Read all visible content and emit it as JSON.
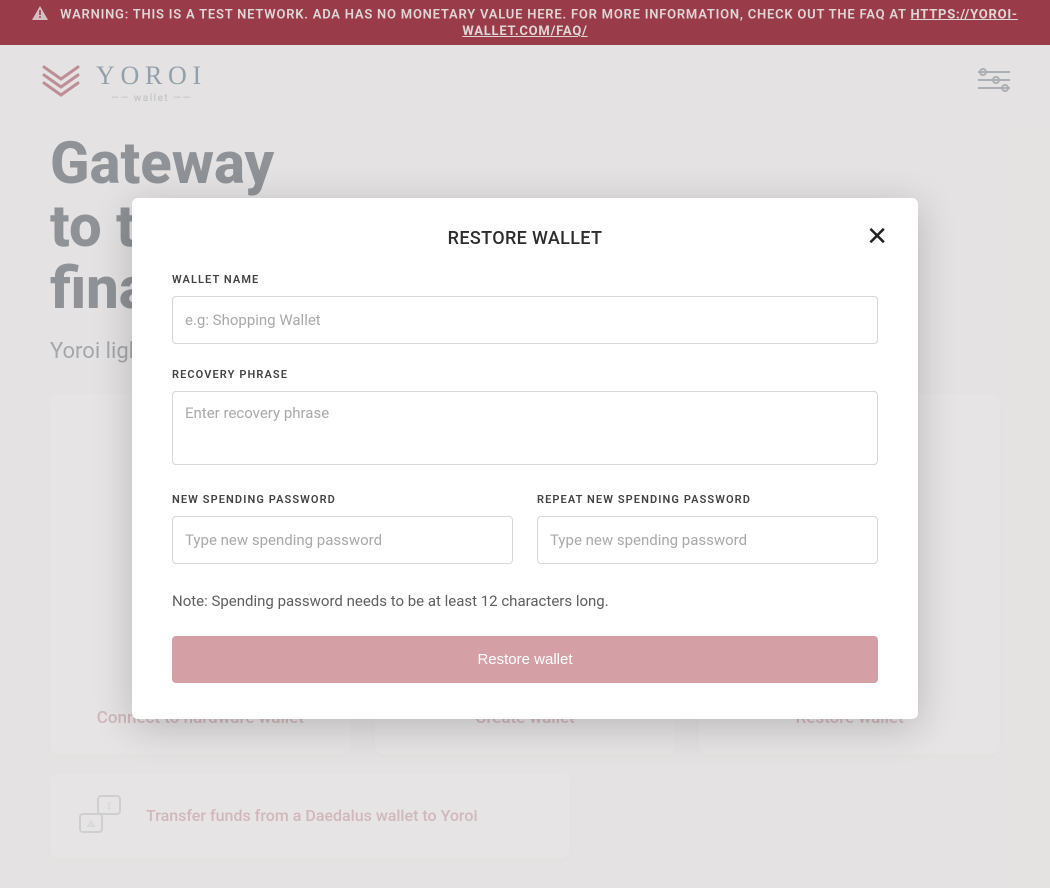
{
  "banner": {
    "text_main": "WARNING: THIS IS A TEST NETWORK. ADA HAS NO MONETARY VALUE HERE. FOR MORE INFORMATION, CHECK OUT THE FAQ AT ",
    "faq_url_text": "HTTPS://YOROI-WALLET.COM/FAQ/"
  },
  "logo": {
    "brand": "YOROI",
    "subtitle": "—— wallet ——"
  },
  "hero": {
    "line1": "Gateway",
    "line2": "to the",
    "line3": "financial world",
    "subtitle": "Yoroi light wallet for Cardano"
  },
  "cards": {
    "hardware": "Connect to hardware wallet",
    "create": "Create wallet",
    "restore": "Restore wallet"
  },
  "transfer": {
    "label": "Transfer funds from a Daedalus wallet to Yoroi"
  },
  "modal": {
    "title": "RESTORE WALLET",
    "wallet_name_label": "WALLET NAME",
    "wallet_name_placeholder": "e.g: Shopping Wallet",
    "wallet_name_value": "",
    "recovery_label": "RECOVERY PHRASE",
    "recovery_placeholder": "Enter recovery phrase",
    "new_pw_label": "NEW SPENDING PASSWORD",
    "new_pw_placeholder": "Type new spending password",
    "repeat_pw_label": "REPEAT NEW SPENDING PASSWORD",
    "repeat_pw_placeholder": "Type new spending password",
    "note": "Note: Spending password needs to be at least 12 characters long.",
    "submit": "Restore wallet"
  }
}
